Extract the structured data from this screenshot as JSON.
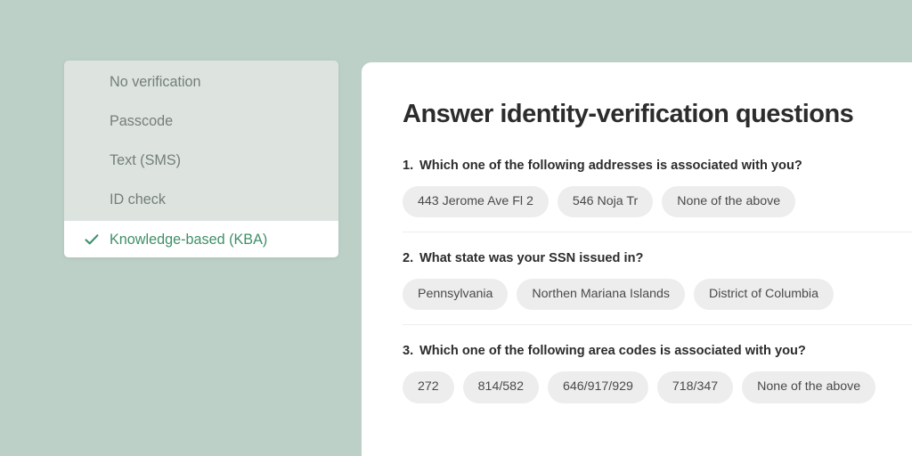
{
  "theme": {
    "page_background": "#bcd0c7",
    "dropdown_background": "#dde4e0",
    "card_background": "#ffffff",
    "accent_green": "#3f8f68",
    "pill_background": "#ededed",
    "muted_text": "#747e79",
    "heading_text": "#2c2c2c"
  },
  "dropdown": {
    "name": "verification-method",
    "items": [
      {
        "label": "No verification",
        "selected": false
      },
      {
        "label": "Passcode",
        "selected": false
      },
      {
        "label": "Text (SMS)",
        "selected": false
      },
      {
        "label": "ID check",
        "selected": false
      },
      {
        "label": "Knowledge-based (KBA)",
        "selected": true
      }
    ],
    "selected_value": "Knowledge-based (KBA)",
    "check_icon": "check-icon"
  },
  "main": {
    "title": "Answer identity-verification questions",
    "questions": [
      {
        "number": "1.",
        "text": "Which one of the following addresses is associated with you?",
        "options": [
          "443 Jerome Ave Fl 2",
          "546 Noja Tr",
          "None of the above"
        ]
      },
      {
        "number": "2.",
        "text": "What state was your SSN issued in?",
        "options": [
          "Pennsylvania",
          "Northen Mariana Islands",
          "District of Columbia"
        ]
      },
      {
        "number": "3.",
        "text": "Which one of the following area codes is associated with you?",
        "options": [
          "272",
          "814/582",
          "646/917/929",
          "718/347",
          "None of the above"
        ]
      }
    ]
  }
}
